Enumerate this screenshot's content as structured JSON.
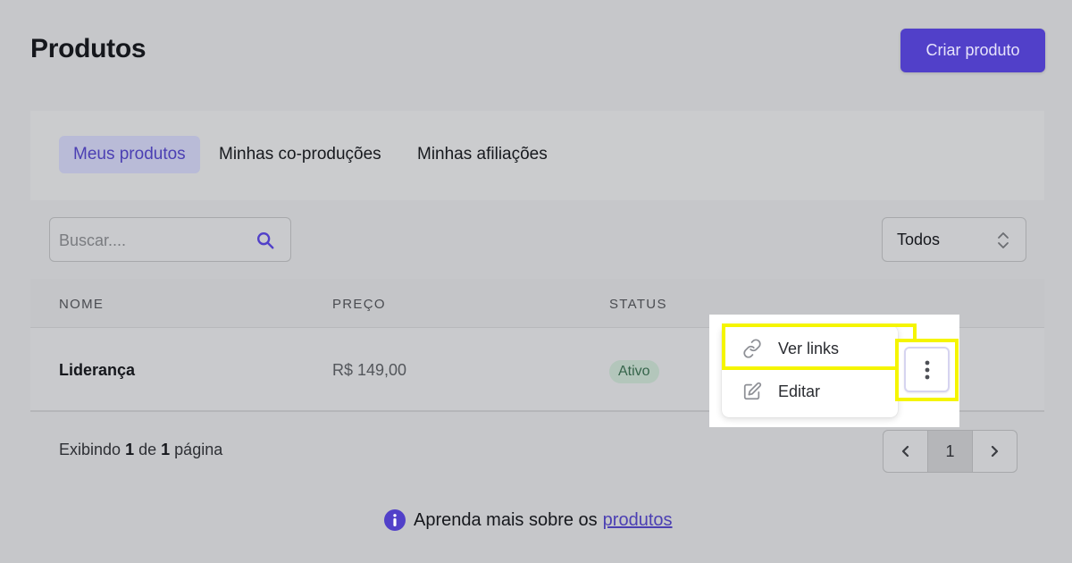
{
  "header": {
    "title": "Produtos",
    "create_button": "Criar produto"
  },
  "tabs": [
    {
      "label": "Meus produtos",
      "active": true
    },
    {
      "label": "Minhas co-produções",
      "active": false
    },
    {
      "label": "Minhas afiliações",
      "active": false
    }
  ],
  "search": {
    "placeholder": "Buscar....",
    "value": "",
    "icon": "search-icon"
  },
  "filter": {
    "selected": "Todos",
    "icon": "chevron-up-down-icon"
  },
  "table": {
    "columns": [
      "NOME",
      "PREÇO",
      "STATUS"
    ],
    "rows": [
      {
        "name": "Liderança",
        "price": "R$ 149,00",
        "status": "Ativo"
      }
    ]
  },
  "pagination": {
    "prefix": "Exibindo",
    "current": "1",
    "middle": "de",
    "total": "1",
    "suffix": "página",
    "page_button": "1"
  },
  "row_menu": {
    "items": [
      {
        "label": "Ver links",
        "icon": "link-icon"
      },
      {
        "label": "Editar",
        "icon": "edit-icon"
      }
    ],
    "trigger_icon": "kebab-icon"
  },
  "help": {
    "text": "Aprenda mais sobre os",
    "link": "produtos",
    "icon": "info-icon"
  },
  "colors": {
    "accent": "#5140c9",
    "highlight": "#f5f500",
    "status_active_bg": "#b3c6bb",
    "status_active_text": "#35644a"
  }
}
